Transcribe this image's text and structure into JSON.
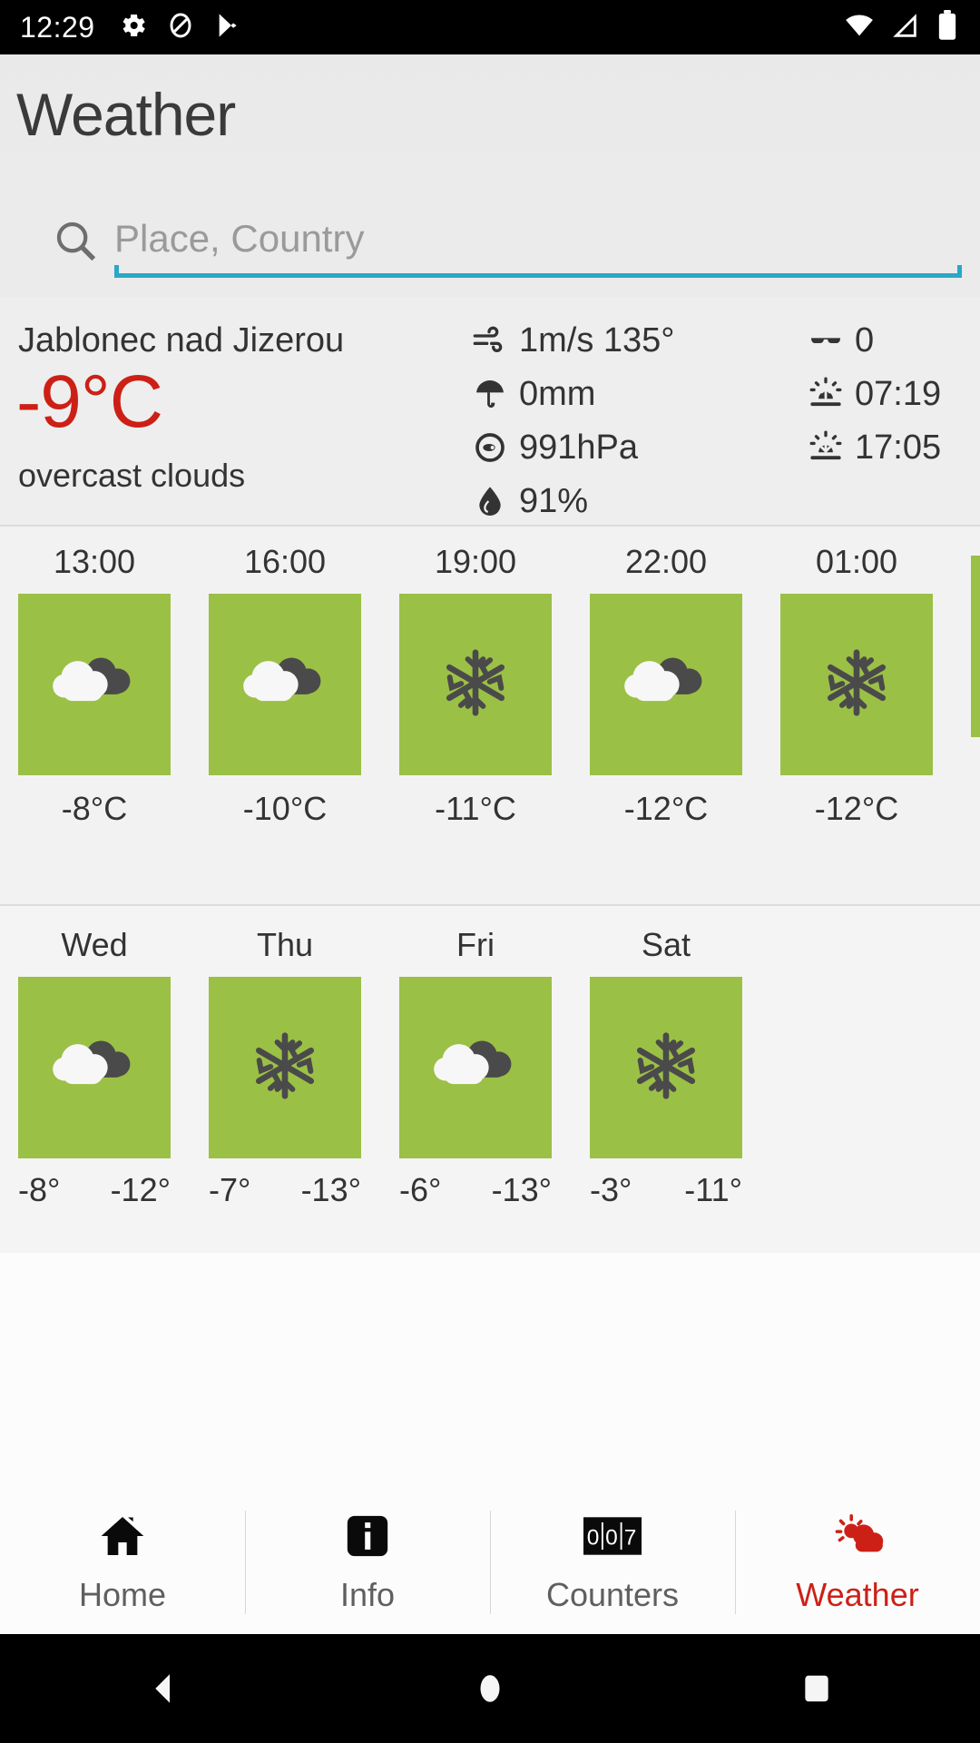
{
  "statusbar": {
    "clock": "12:29",
    "left_icons": [
      "gear-icon",
      "do-not-disturb-icon",
      "play-store-icon"
    ],
    "right_icons": [
      "wifi-icon",
      "cell-signal-icon",
      "battery-icon"
    ]
  },
  "appbar": {
    "title": "Weather"
  },
  "search": {
    "placeholder": "Place, Country",
    "value": "",
    "icon": "search-icon",
    "underline_color": "#29a8c8"
  },
  "current": {
    "place": "Jablonec nad Jizerou",
    "temperature": "-9°C",
    "temperature_color": "#cc2017",
    "description": "overcast clouds",
    "metrics_mid": [
      {
        "icon": "wind-icon",
        "value": "1m/s 135°"
      },
      {
        "icon": "umbrella-icon",
        "value": "0mm"
      },
      {
        "icon": "barometer-icon",
        "value": "991hPa"
      },
      {
        "icon": "droplet-icon",
        "value": "91%"
      }
    ],
    "metrics_right": [
      {
        "icon": "sunglasses-icon",
        "value": "0"
      },
      {
        "icon": "sunrise-icon",
        "value": "07:19"
      },
      {
        "icon": "sunset-icon",
        "value": "17:05"
      }
    ]
  },
  "hourly": {
    "tile_color": "#9bc046",
    "items": [
      {
        "time": "13:00",
        "icon": "cloudy-icon",
        "temp": "-8°C"
      },
      {
        "time": "16:00",
        "icon": "cloudy-icon",
        "temp": "-10°C"
      },
      {
        "time": "19:00",
        "icon": "snowflake-icon",
        "temp": "-11°C"
      },
      {
        "time": "22:00",
        "icon": "cloudy-icon",
        "temp": "-12°C"
      },
      {
        "time": "01:00",
        "icon": "snowflake-icon",
        "temp": "-12°C"
      },
      {
        "time": "",
        "icon": "cloudy-icon",
        "temp": ""
      }
    ]
  },
  "daily": {
    "tile_color": "#9bc046",
    "items": [
      {
        "day": "Wed",
        "icon": "cloudy-icon",
        "high": "-8°",
        "low": "-12°"
      },
      {
        "day": "Thu",
        "icon": "snowflake-icon",
        "high": "-7°",
        "low": "-13°"
      },
      {
        "day": "Fri",
        "icon": "cloudy-icon",
        "high": "-6°",
        "low": "-13°"
      },
      {
        "day": "Sat",
        "icon": "snowflake-icon",
        "high": "-3°",
        "low": "-11°"
      }
    ]
  },
  "bottomnav": {
    "active_color": "#cc2017",
    "items": [
      {
        "label": "Home",
        "icon": "home-icon",
        "active": false
      },
      {
        "label": "Info",
        "icon": "info-icon",
        "active": false
      },
      {
        "label": "Counters",
        "icon": "counters-icon",
        "active": false
      },
      {
        "label": "Weather",
        "icon": "weather-icon",
        "active": true
      }
    ]
  },
  "androidnav": {
    "buttons": [
      "back-icon",
      "home-circle-icon",
      "recents-icon"
    ]
  }
}
